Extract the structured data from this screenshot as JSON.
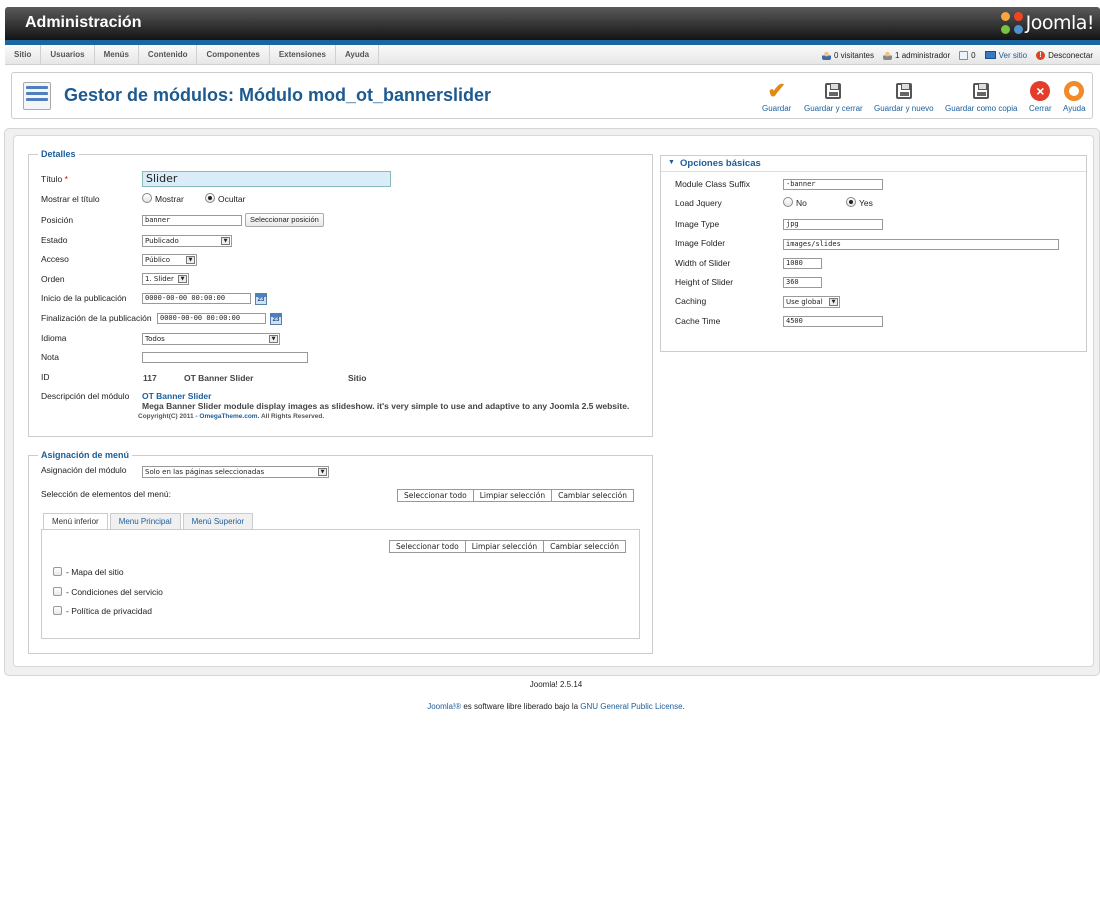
{
  "header": {
    "title": "Administración",
    "logo_text": "Joomla!"
  },
  "menu": [
    "Sitio",
    "Usuarios",
    "Menús",
    "Contenido",
    "Componentes",
    "Extensiones",
    "Ayuda"
  ],
  "status": {
    "visitors": "0 visitantes",
    "admins": "1 administrador",
    "messages": "0",
    "view_site": "Ver sitio",
    "logout": "Desconectar"
  },
  "toolbar": {
    "page_title": "Gestor de módulos: Módulo mod_ot_bannerslider",
    "save": "Guardar",
    "save_close": "Guardar y cerrar",
    "save_new": "Guardar y nuevo",
    "save_copy": "Guardar como copia",
    "close": "Cerrar",
    "help": "Ayuda"
  },
  "details": {
    "legend": "Detalles",
    "title_label": "Título",
    "required_mark": "*",
    "title_value": "Slider",
    "show_title_label": "Mostrar el título",
    "show_option": "Mostrar",
    "hide_option": "Ocultar",
    "position_label": "Posición",
    "position_value": "banner",
    "select_position": "Seleccionar posición",
    "state_label": "Estado",
    "state_value": "Publicado",
    "access_label": "Acceso",
    "access_value": "Público",
    "order_label": "Orden",
    "order_value": "1. Slider",
    "publish_up_label": "Inicio de la publicación",
    "publish_up_value": "0000-00-00 00:00:00",
    "publish_down_label": "Finalización de la publicación",
    "publish_down_value": "0000-00-00 00:00:00",
    "calendar_day": "23",
    "language_label": "Idioma",
    "language_value": "Todos",
    "note_label": "Nota",
    "note_value": "",
    "id_label": "ID",
    "id_value": "117",
    "module_name": "OT Banner Slider",
    "client": "Sitio",
    "desc_label": "Descripción del módulo",
    "desc_title": "OT Banner Slider",
    "desc_text": "Mega Banner Slider module display images as slideshow. it's very simple to use and adaptive to any Joomla 2.5 website.",
    "copyright_pre": "Copyright(C) 2011 -",
    "copyright_link": "OmegaTheme.com",
    "copyright_post": ". All Rights Reserved."
  },
  "menu_assignment": {
    "legend": "Asignación de menú",
    "assign_label": "Asignación del módulo",
    "assign_value": "Solo en las páginas seleccionadas",
    "selection_label": "Selección de elementos del menú:",
    "select_all": "Seleccionar todo",
    "clear_selection": "Limpiar selección",
    "toggle_selection": "Cambiar selección",
    "tabs": [
      "Menú inferior",
      "Menu Principal",
      "Menú Superior"
    ],
    "items": [
      "- Mapa del sitio",
      "- Condiciones del servicio",
      "- Política de privacidad"
    ]
  },
  "options": {
    "header": "Opciones básicas",
    "class_suffix_label": "Module Class Suffix",
    "class_suffix_value": "-banner",
    "jquery_label": "Load Jquery",
    "no": "No",
    "yes": "Yes",
    "image_type_label": "Image Type",
    "image_type_value": "jpg",
    "image_folder_label": "Image Folder",
    "image_folder_value": "images/slides",
    "width_label": "Width of Slider",
    "width_value": "1080",
    "height_label": "Height of Slider",
    "height_value": "360",
    "caching_label": "Caching",
    "caching_value": "Use global",
    "cache_time_label": "Cache Time",
    "cache_time_value": "4500"
  },
  "footer": {
    "version": "Joomla! 2.5.14",
    "license_link1": "Joomla!®",
    "license_text": " es software libre liberado bajo la ",
    "license_link2": "GNU General Public License",
    "license_end": "."
  }
}
